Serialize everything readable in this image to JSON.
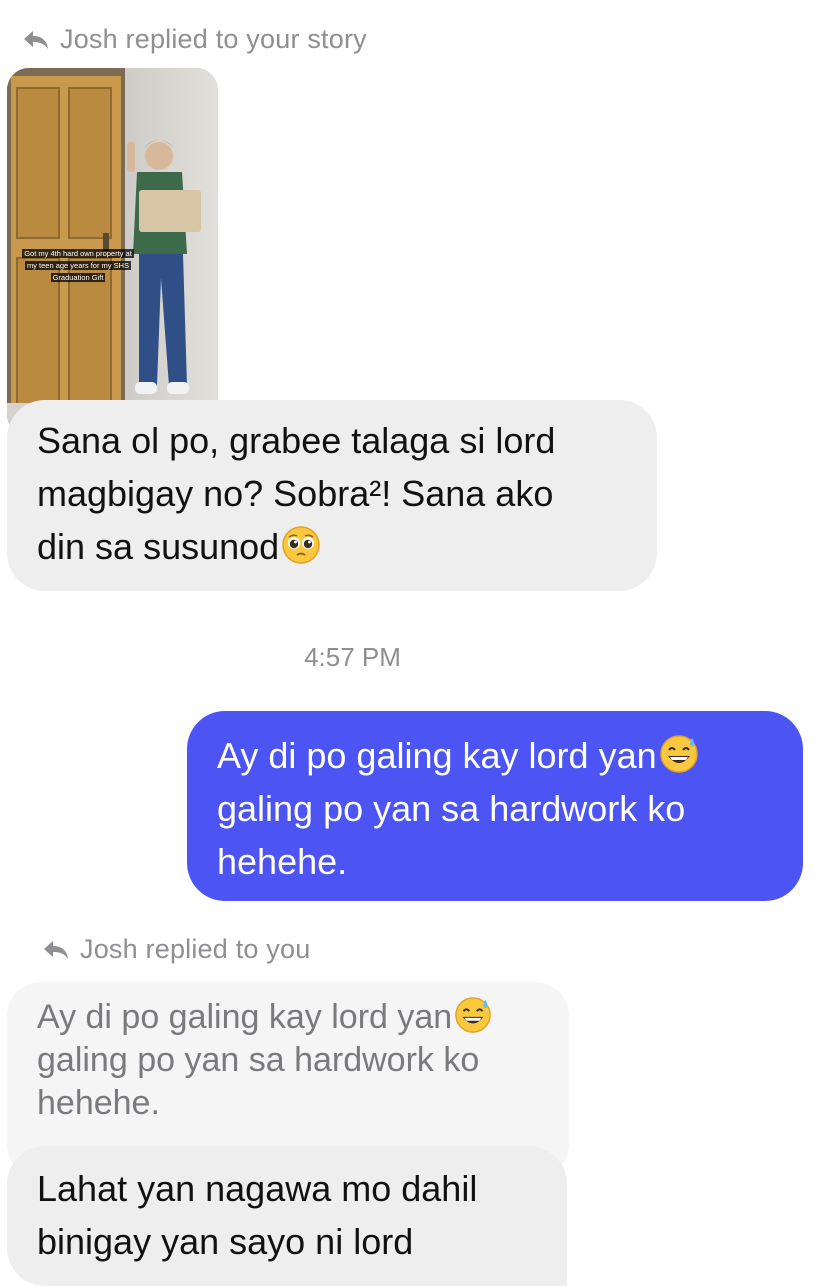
{
  "story_reply": {
    "header": "Josh replied to your story",
    "story_caption_lines": [
      "Got my 4th hard own property at",
      "my teen age years for my SHS",
      "Graduation Gift"
    ],
    "message_lines": [
      "Sana ol po, grabee talaga si lord",
      "magbigay no? Sobra²! Sana ako",
      "din sa susunod"
    ],
    "emoji": "pleading-face-emoji"
  },
  "timestamp": "4:57 PM",
  "sent_message": {
    "lines": [
      "Ay di po galing kay lord yan",
      "galing po yan sa hardwork ko",
      "hehehe."
    ],
    "emoji": "grinning-sweat-emoji"
  },
  "reply_to_you": {
    "header": "Josh replied to you",
    "quoted_lines": [
      "Ay di po galing kay lord yan",
      "galing po yan sa hardwork ko",
      "hehehe."
    ],
    "quoted_emoji": "grinning-sweat-emoji",
    "message_lines": [
      "Lahat yan nagawa mo dahil",
      "binigay yan sayo ni lord"
    ]
  },
  "colors": {
    "outgoing_bubble": "#4c55f4",
    "incoming_bubble": "#eeeeef",
    "meta_text": "#8e8e93"
  }
}
